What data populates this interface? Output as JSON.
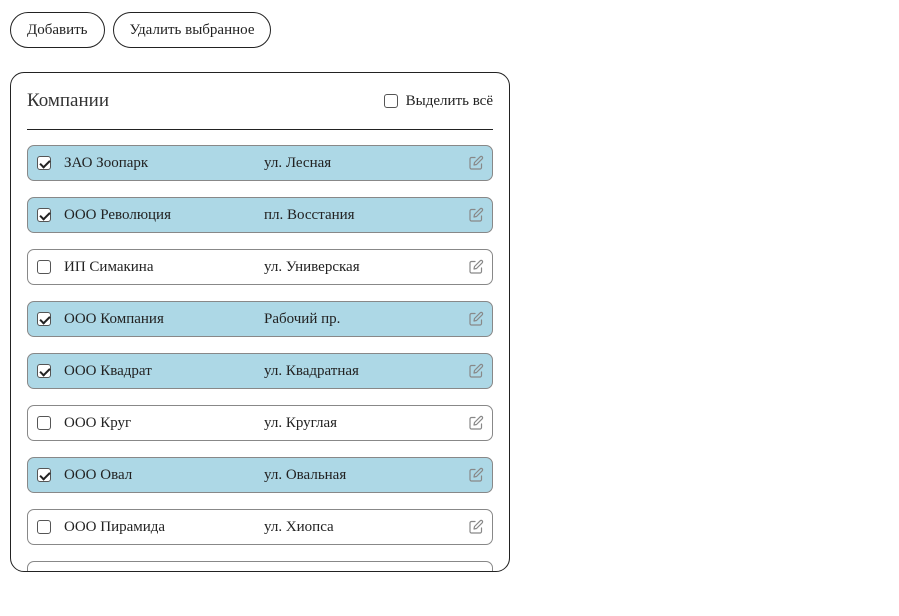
{
  "toolbar": {
    "add_label": "Добавить",
    "delete_selected_label": "Удалить выбранное"
  },
  "panel": {
    "title": "Компании",
    "select_all_label": "Выделить всё",
    "select_all_checked": false
  },
  "companies": [
    {
      "name": "ЗАО Зоопарк",
      "address": "ул. Лесная",
      "selected": true
    },
    {
      "name": "ООО Революция",
      "address": "пл. Восстания",
      "selected": true
    },
    {
      "name": "ИП Симакина",
      "address": "ул. Универская",
      "selected": false
    },
    {
      "name": "ООО Компания",
      "address": "Рабочий пр.",
      "selected": true
    },
    {
      "name": "ООО Квадрат",
      "address": "ул. Квадратная",
      "selected": true
    },
    {
      "name": "ООО Круг",
      "address": "ул. Круглая",
      "selected": false
    },
    {
      "name": "ООО Овал",
      "address": "ул. Овальная",
      "selected": true
    },
    {
      "name": "ООО Пирамида",
      "address": "ул. Хиопса",
      "selected": false
    },
    {
      "name": "",
      "address": "",
      "selected": false
    }
  ],
  "colors": {
    "selected_row_bg": "#add8e6",
    "border": "#222222",
    "row_border": "#888888"
  },
  "icons": {
    "row_edit": "edit-icon"
  }
}
